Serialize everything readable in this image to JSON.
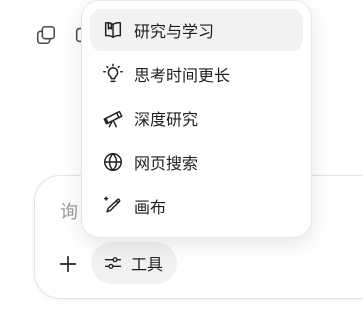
{
  "header": {
    "icons": [
      "copy-icon",
      "partial-icon"
    ]
  },
  "menu": {
    "items": [
      {
        "label": "研究与学习",
        "icon": "book-open-icon",
        "active": true
      },
      {
        "label": "思考时间更长",
        "icon": "lightbulb-icon",
        "active": false
      },
      {
        "label": "深度研究",
        "icon": "telescope-icon",
        "active": false
      },
      {
        "label": "网页搜索",
        "icon": "globe-icon",
        "active": false
      },
      {
        "label": "画布",
        "icon": "pen-sparkle-icon",
        "active": false
      }
    ]
  },
  "composer": {
    "placeholder": "询",
    "plus_icon": "plus-icon",
    "tools_label": "工具",
    "tools_icon": "sliders-icon"
  },
  "colors": {
    "menu_active_bg": "#f2f2f2",
    "tools_btn_bg": "#f1f1f1",
    "text": "#1f1f1f",
    "placeholder": "#9a9a9a"
  }
}
